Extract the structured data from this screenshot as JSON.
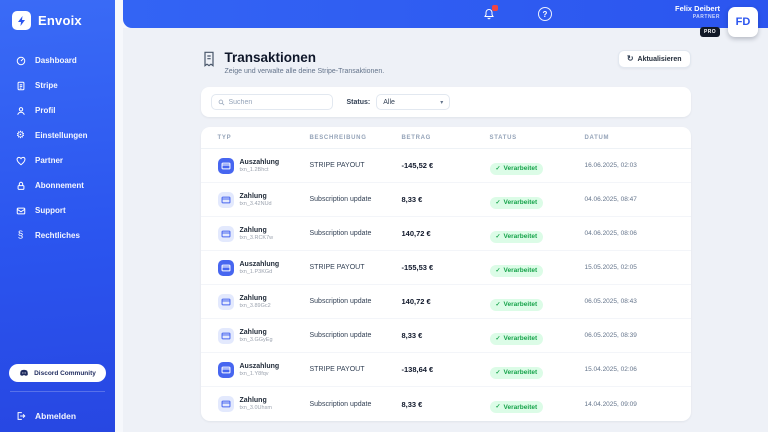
{
  "brand": {
    "name": "Envoix"
  },
  "header": {
    "user_name": "Felix Deibert",
    "user_role": "PARTNER",
    "plan_badge": "PRO",
    "avatar_initials": "FD"
  },
  "sidebar": {
    "items": [
      {
        "label": "Dashboard",
        "icon": "gauge-icon"
      },
      {
        "label": "Stripe",
        "icon": "document-icon"
      },
      {
        "label": "Profil",
        "icon": "user-icon"
      },
      {
        "label": "Einstellungen",
        "icon": "gear-icon"
      },
      {
        "label": "Partner",
        "icon": "heart-icon"
      },
      {
        "label": "Abonnement",
        "icon": "lock-icon"
      },
      {
        "label": "Support",
        "icon": "mail-icon"
      },
      {
        "label": "Rechtliches",
        "icon": "legal-icon"
      }
    ],
    "discord_label": "Discord Community",
    "logout_label": "Abmelden"
  },
  "page": {
    "title": "Transaktionen",
    "subtitle": "Zeige und verwalte alle deine Stripe-Transaktionen.",
    "refresh_label": "Aktualisieren"
  },
  "filters": {
    "search_placeholder": "Suchen",
    "status_label": "Status:",
    "status_value": "Alle"
  },
  "table": {
    "columns": [
      "TYP",
      "BESCHREIBUNG",
      "BETRAG",
      "STATUS",
      "DATUM"
    ],
    "rows": [
      {
        "type": "Auszahlung",
        "txn": "txn_1.2Bhct",
        "description": "STRIPE PAYOUT",
        "amount": "-145,52 €",
        "status": "Verarbeitet",
        "date": "16.06.2025, 02:03",
        "kind": "payout"
      },
      {
        "type": "Zahlung",
        "txn": "txn_3.42NUd",
        "description": "Subscription update",
        "amount": "8,33 €",
        "status": "Verarbeitet",
        "date": "04.06.2025, 08:47",
        "kind": "payment"
      },
      {
        "type": "Zahlung",
        "txn": "txn_3.RCK7w",
        "description": "Subscription update",
        "amount": "140,72 €",
        "status": "Verarbeitet",
        "date": "04.06.2025, 08:06",
        "kind": "payment"
      },
      {
        "type": "Auszahlung",
        "txn": "txn_1.P3KGd",
        "description": "STRIPE PAYOUT",
        "amount": "-155,53 €",
        "status": "Verarbeitet",
        "date": "15.05.2025, 02:05",
        "kind": "payout"
      },
      {
        "type": "Zahlung",
        "txn": "txn_3.89Gc2",
        "description": "Subscription update",
        "amount": "140,72 €",
        "status": "Verarbeitet",
        "date": "06.05.2025, 08:43",
        "kind": "payment"
      },
      {
        "type": "Zahlung",
        "txn": "txn_3.GGyEg",
        "description": "Subscription update",
        "amount": "8,33 €",
        "status": "Verarbeitet",
        "date": "06.05.2025, 08:39",
        "kind": "payment"
      },
      {
        "type": "Auszahlung",
        "txn": "txn_1.Y8fqv",
        "description": "STRIPE PAYOUT",
        "amount": "-138,64 €",
        "status": "Verarbeitet",
        "date": "15.04.2025, 02:06",
        "kind": "payout"
      },
      {
        "type": "Zahlung",
        "txn": "txn_3.0Uhsm",
        "description": "Subscription update",
        "amount": "8,33 €",
        "status": "Verarbeitet",
        "date": "14.04.2025, 09:09",
        "kind": "payment"
      }
    ]
  },
  "icons": {
    "gear": "⚙",
    "legal": "§",
    "check": "✓",
    "chevron": "▾",
    "help": "?",
    "refresh": "↻"
  },
  "colors": {
    "accent_blue": "#2b55ef",
    "success_bg": "#dcfce7",
    "success_text": "#16a34a",
    "payout_icon_bg": "#4766f0"
  }
}
